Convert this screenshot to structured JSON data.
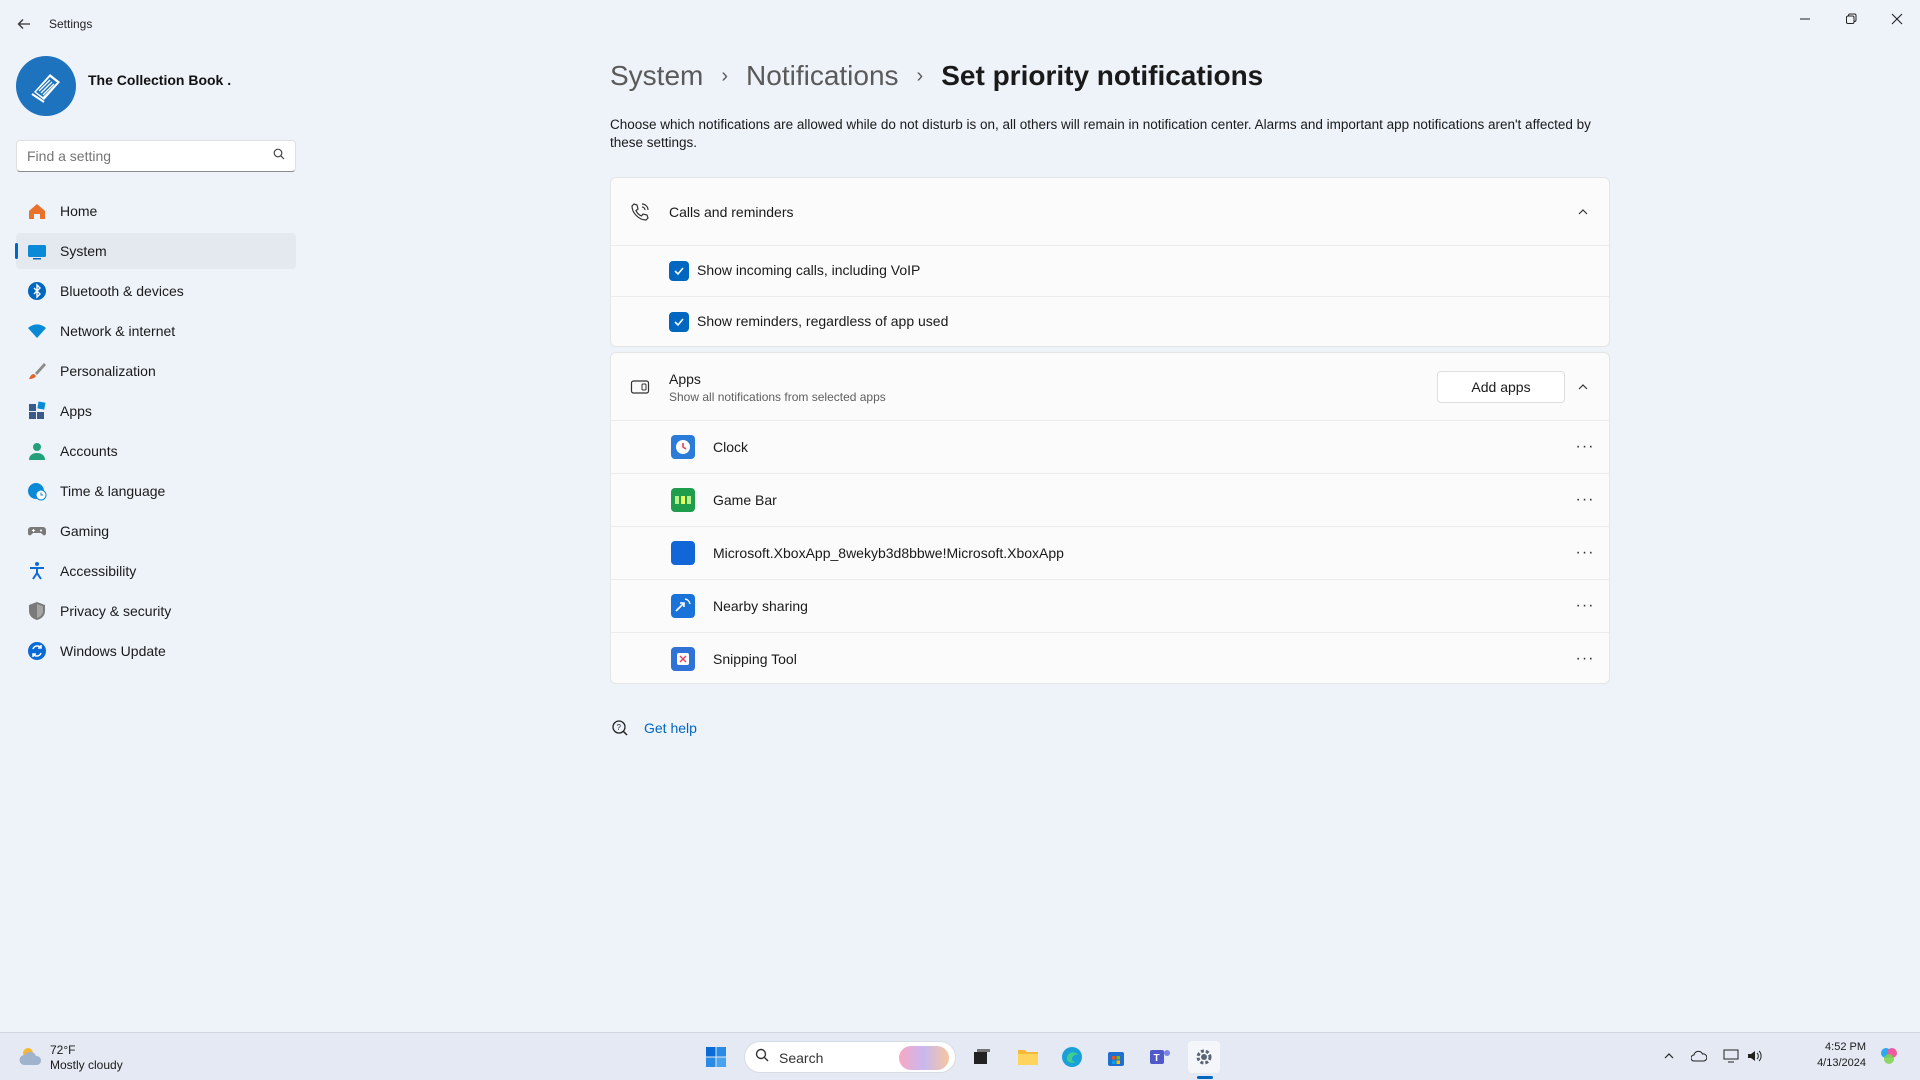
{
  "window": {
    "title": "Settings",
    "back_icon": "back-arrow-icon",
    "minimize_icon": "minimize-icon",
    "restore_icon": "restore-icon",
    "close_icon": "close-icon"
  },
  "profile": {
    "name": "The Collection Book ."
  },
  "search": {
    "placeholder": "Find a setting",
    "icon": "search-icon"
  },
  "nav": [
    {
      "label": "Home",
      "icon": "home-icon",
      "color": "#e8722c"
    },
    {
      "label": "System",
      "icon": "system-icon",
      "color": "#0067c0",
      "active": true
    },
    {
      "label": "Bluetooth & devices",
      "icon": "bluetooth-icon",
      "color": "#0067c0"
    },
    {
      "label": "Network & internet",
      "icon": "wifi-icon",
      "color": "#0a8ad6"
    },
    {
      "label": "Personalization",
      "icon": "brush-icon",
      "color": "#e0642a"
    },
    {
      "label": "Apps",
      "icon": "apps-icon",
      "color": "#3b5a8a"
    },
    {
      "label": "Accounts",
      "icon": "accounts-icon",
      "color": "#22a07a"
    },
    {
      "label": "Time & language",
      "icon": "globe-clock-icon",
      "color": "#0a8ad6"
    },
    {
      "label": "Gaming",
      "icon": "gamepad-icon",
      "color": "#6b6b6b"
    },
    {
      "label": "Accessibility",
      "icon": "accessibility-icon",
      "color": "#0a6ad6"
    },
    {
      "label": "Privacy & security",
      "icon": "shield-icon",
      "color": "#6b6b6b"
    },
    {
      "label": "Windows Update",
      "icon": "update-icon",
      "color": "#0a6ad6"
    }
  ],
  "breadcrumb": {
    "items": [
      "System",
      "Notifications"
    ],
    "current": "Set priority notifications"
  },
  "description": "Choose which notifications are allowed while do not disturb is on, all others will remain in notification center. Alarms and important app notifications aren't affected by these settings.",
  "calls_card": {
    "title": "Calls and reminders",
    "icon": "phone-ringing-icon",
    "options": [
      {
        "label": "Show incoming calls, including VoIP",
        "checked": true
      },
      {
        "label": "Show reminders, regardless of app used",
        "checked": true
      }
    ]
  },
  "apps_card": {
    "title": "Apps",
    "subtitle": "Show all notifications from selected apps",
    "icon": "app-window-icon",
    "add_button": "Add apps",
    "apps": [
      {
        "name": "Clock",
        "icon": "clock-icon",
        "color": "#2b7bd8"
      },
      {
        "name": "Game Bar",
        "icon": "game-bar-icon",
        "color": "#1e9e4a"
      },
      {
        "name": "Microsoft.XboxApp_8wekyb3d8bbwe!Microsoft.XboxApp",
        "icon": "xbox-app-icon",
        "color": "#1267d8"
      },
      {
        "name": "Nearby sharing",
        "icon": "nearby-sharing-icon",
        "color": "#1a73d9"
      },
      {
        "name": "Snipping Tool",
        "icon": "snipping-tool-icon",
        "color": "#2f73d6"
      }
    ]
  },
  "help": {
    "label": "Get help",
    "icon": "help-chat-icon"
  },
  "taskbar": {
    "weather_temp": "72°F",
    "weather_desc": "Mostly cloudy",
    "search_label": "Search",
    "time": "4:52 PM",
    "date": "4/13/2024"
  }
}
